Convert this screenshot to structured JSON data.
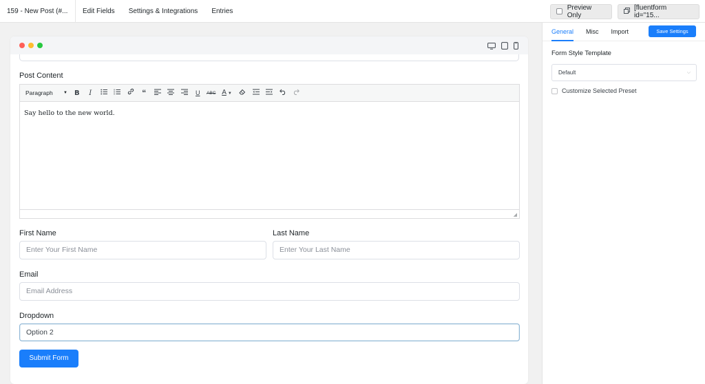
{
  "topbar": {
    "form_title": "159 - New Post (#...",
    "nav": [
      "Edit Fields",
      "Settings & Integrations",
      "Entries"
    ],
    "preview_label": "Preview Only",
    "shortcode_label": "[fluentform id=\"15..."
  },
  "editor": {
    "label": "Post Content",
    "format": "Paragraph",
    "content": "Say hello to the new world.",
    "toolbar_icons": [
      "bold-icon",
      "italic-icon",
      "bullet-list-icon",
      "numbered-list-icon",
      "link-icon",
      "blockquote-icon",
      "align-left-icon",
      "align-center-icon",
      "align-right-icon",
      "underline-icon",
      "strikethrough-icon",
      "text-color-icon",
      "clear-format-icon",
      "outdent-icon",
      "indent-icon",
      "undo-icon",
      "redo-icon"
    ]
  },
  "form": {
    "first_name_label": "First Name",
    "first_name_placeholder": "Enter Your First Name",
    "last_name_label": "Last Name",
    "last_name_placeholder": "Enter Your Last Name",
    "email_label": "Email",
    "email_placeholder": "Email Address",
    "dropdown_label": "Dropdown",
    "dropdown_value": "Option 2",
    "submit_label": "Submit Form"
  },
  "panel": {
    "tabs": [
      "General",
      "Misc",
      "Import"
    ],
    "save_label": "Save Settings",
    "style_template_label": "Form Style Template",
    "style_template_value": "Default",
    "customize_label": "Customize Selected Preset"
  },
  "colors": {
    "accent": "#1a7efb",
    "mac_red": "#ff5f57",
    "mac_yellow": "#febc2e",
    "mac_green": "#28c840"
  }
}
